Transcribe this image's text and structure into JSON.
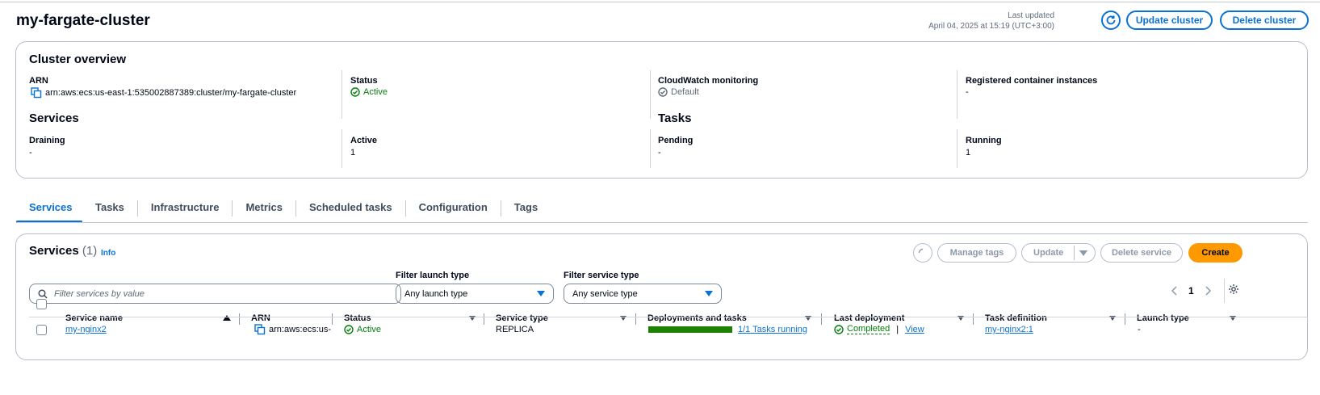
{
  "header": {
    "title": "my-fargate-cluster",
    "last_updated_label": "Last updated",
    "last_updated_value": "April 04, 2025 at 15:19 (UTC+3:00)",
    "update_cluster": "Update cluster",
    "delete_cluster": "Delete cluster"
  },
  "overview": {
    "title": "Cluster overview",
    "arn_label": "ARN",
    "arn_value": "arn:aws:ecs:us-east-1:535002887389:cluster/my-fargate-cluster",
    "status_label": "Status",
    "status_value": "Active",
    "cloudwatch_label": "CloudWatch monitoring",
    "cloudwatch_value": "Default",
    "registered_label": "Registered container instances",
    "registered_value": "-",
    "services_title": "Services",
    "draining_label": "Draining",
    "draining_value": "-",
    "active_label": "Active",
    "active_value": "1",
    "tasks_title": "Tasks",
    "pending_label": "Pending",
    "pending_value": "-",
    "running_label": "Running",
    "running_value": "1"
  },
  "tabs": [
    "Services",
    "Tasks",
    "Infrastructure",
    "Metrics",
    "Scheduled tasks",
    "Configuration",
    "Tags"
  ],
  "services": {
    "title": "Services",
    "count": "(1)",
    "info": "Info",
    "manage_tags": "Manage tags",
    "update": "Update",
    "delete_service": "Delete service",
    "create": "Create",
    "filter_launch_label": "Filter launch type",
    "filter_launch_value": "Any launch type",
    "filter_service_label": "Filter service type",
    "filter_service_value": "Any service type",
    "search_placeholder": "Filter services by value",
    "page": "1",
    "columns": [
      "Service name",
      "ARN",
      "Status",
      "Service type",
      "Deployments and tasks",
      "Last deployment",
      "Task definition",
      "Launch type"
    ],
    "row": {
      "name": "my-nginx2",
      "arn": "arn:aws:ecs:us-e",
      "status": "Active",
      "service_type": "REPLICA",
      "tasks_text": "1/1 Tasks running",
      "tasks_progress": 1.0,
      "deployment": "Completed",
      "deployment_sep": "|",
      "view": "View",
      "task_definition": "my-nginx2:1",
      "launch_type": "-"
    }
  },
  "colors": {
    "accent": "#0972d3",
    "success": "#037f0c",
    "primary_button": "#ff9900"
  }
}
